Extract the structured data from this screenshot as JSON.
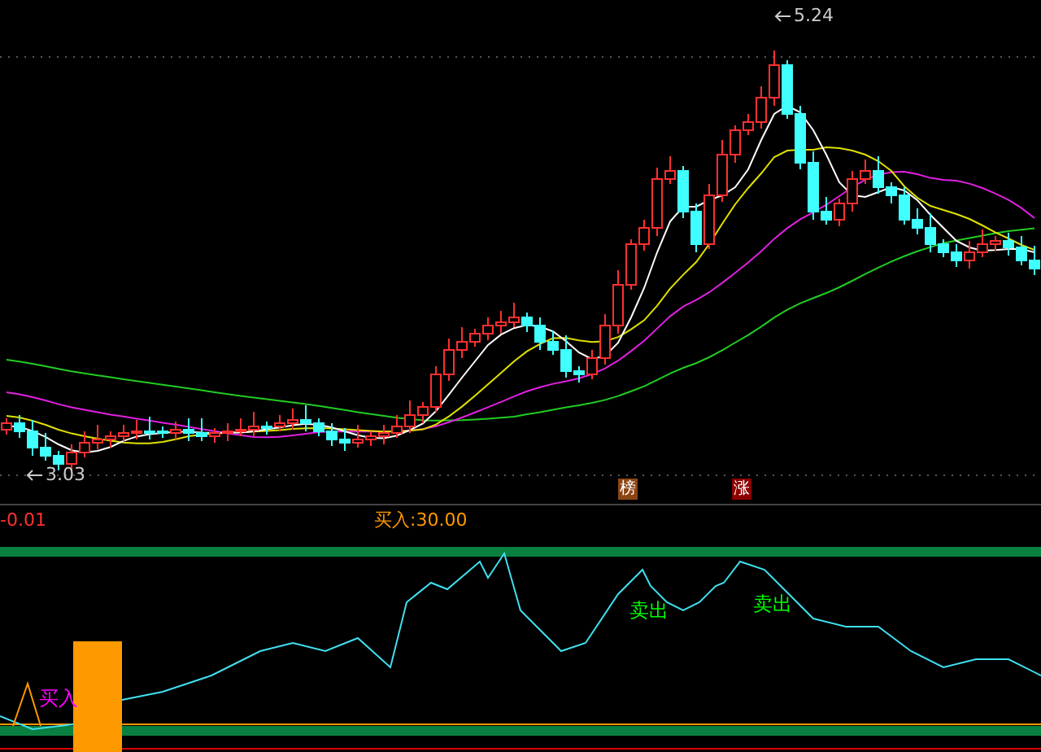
{
  "main_chart": {
    "high_label": "5.24",
    "low_label": "3.03",
    "badges": [
      {
        "text": "榜",
        "color": "#8b4513"
      },
      {
        "text": "涨",
        "color": "#8b0000"
      }
    ]
  },
  "indicator": {
    "reading": "-0.01",
    "title": "买入:30.00",
    "signals": [
      {
        "kind": "buy",
        "text": "买入"
      },
      {
        "kind": "sell",
        "text": "卖出"
      },
      {
        "kind": "sell",
        "text": "卖出"
      }
    ]
  }
}
